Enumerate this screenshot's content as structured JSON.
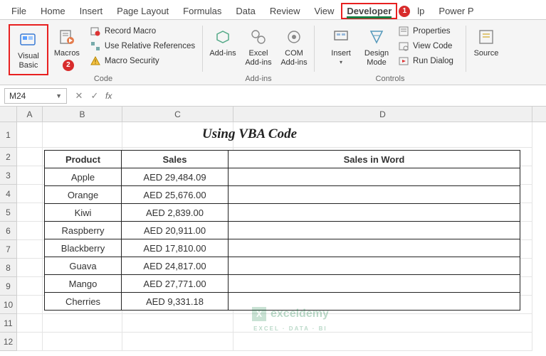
{
  "tabs": {
    "file": "File",
    "home": "Home",
    "insert": "Insert",
    "page_layout": "Page Layout",
    "formulas": "Formulas",
    "data": "Data",
    "review": "Review",
    "view": "View",
    "developer": "Developer",
    "help_partial": "lp",
    "power_partial": "Power P"
  },
  "callouts": {
    "one": "1",
    "two": "2"
  },
  "ribbon": {
    "visual_basic": "Visual Basic",
    "macros": "Macros",
    "record_macro": "Record Macro",
    "use_relative": "Use Relative References",
    "macro_security": "Macro Security",
    "code_group": "Code",
    "addins": "Add-ins",
    "excel_addins": "Excel Add-ins",
    "com_addins": "COM Add-ins",
    "addins_group": "Add-ins",
    "insert": "Insert",
    "design_mode": "Design Mode",
    "properties": "Properties",
    "view_code": "View Code",
    "run_dialog": "Run Dialog",
    "controls_group": "Controls",
    "source": "Source"
  },
  "formula_bar": {
    "name_box": "M24",
    "fx": "fx"
  },
  "columns": [
    "A",
    "B",
    "C",
    "D"
  ],
  "rows": [
    "1",
    "2",
    "3",
    "4",
    "5",
    "6",
    "7",
    "8",
    "9",
    "10",
    "11",
    "12"
  ],
  "col_widths": {
    "A": 36,
    "B": 112,
    "C": 156,
    "D": 420
  },
  "title": "Using VBA Code",
  "table": {
    "headers": {
      "product": "Product",
      "sales": "Sales",
      "word": "Sales in Word"
    },
    "rows": [
      {
        "product": "Apple",
        "sales": "AED 29,484.09"
      },
      {
        "product": "Orange",
        "sales": "AED 25,676.00"
      },
      {
        "product": "Kiwi",
        "sales": "AED 2,839.00"
      },
      {
        "product": "Raspberry",
        "sales": "AED 20,911.00"
      },
      {
        "product": "Blackberry",
        "sales": "AED 17,810.00"
      },
      {
        "product": "Guava",
        "sales": "AED 24,817.00"
      },
      {
        "product": "Mango",
        "sales": "AED 27,771.00"
      },
      {
        "product": "Cherries",
        "sales": "AED 9,331.18"
      }
    ]
  },
  "watermark": {
    "brand": "exceldemy",
    "sub": "EXCEL · DATA · BI"
  },
  "chart_data": {
    "type": "table",
    "title": "Using VBA Code",
    "columns": [
      "Product",
      "Sales",
      "Sales in Word"
    ],
    "rows": [
      [
        "Apple",
        29484.09,
        ""
      ],
      [
        "Orange",
        25676.0,
        ""
      ],
      [
        "Kiwi",
        2839.0,
        ""
      ],
      [
        "Raspberry",
        20911.0,
        ""
      ],
      [
        "Blackberry",
        17810.0,
        ""
      ],
      [
        "Guava",
        24817.0,
        ""
      ],
      [
        "Mango",
        27771.0,
        ""
      ],
      [
        "Cherries",
        9331.18,
        ""
      ]
    ],
    "currency": "AED"
  }
}
